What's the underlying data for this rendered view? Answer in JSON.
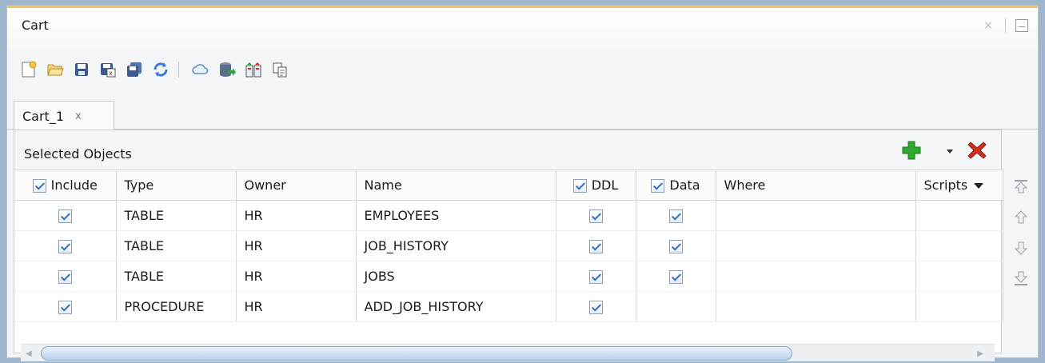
{
  "window": {
    "title": "Cart",
    "close_glyph": "×"
  },
  "toolbar": {
    "buttons": [
      "new-cart-icon",
      "open-cart-icon",
      "save-cart-icon",
      "save-as-excel-icon",
      "save-all-icon",
      "refresh-icon",
      "cloud-deploy-icon",
      "export-database-icon",
      "compare-icon",
      "copy-icon"
    ]
  },
  "tabs": [
    {
      "label": "Cart_1",
      "close": "x"
    }
  ],
  "panel": {
    "title": "Selected Objects"
  },
  "table": {
    "columns": {
      "include": "Include",
      "type": "Type",
      "owner": "Owner",
      "name": "Name",
      "ddl": "DDL",
      "data": "Data",
      "where": "Where",
      "scripts": "Scripts"
    },
    "rows": [
      {
        "type": "TABLE",
        "owner": "HR",
        "name": "EMPLOYEES",
        "include": true,
        "ddl": true,
        "data": true,
        "where": ""
      },
      {
        "type": "TABLE",
        "owner": "HR",
        "name": "JOB_HISTORY",
        "include": true,
        "ddl": true,
        "data": true,
        "where": ""
      },
      {
        "type": "TABLE",
        "owner": "HR",
        "name": "JOBS",
        "include": true,
        "ddl": true,
        "data": true,
        "where": ""
      },
      {
        "type": "PROCEDURE",
        "owner": "HR",
        "name": "ADD_JOB_HISTORY",
        "include": true,
        "ddl": true,
        "data": null,
        "where": ""
      }
    ]
  },
  "side_buttons": [
    "move-top-icon",
    "move-up-icon",
    "move-down-icon",
    "move-bottom-icon"
  ],
  "colors": {
    "accent": "#f7c64d",
    "check": "#2f6fc6",
    "add": "#2ea72e",
    "delete": "#d0301e"
  }
}
